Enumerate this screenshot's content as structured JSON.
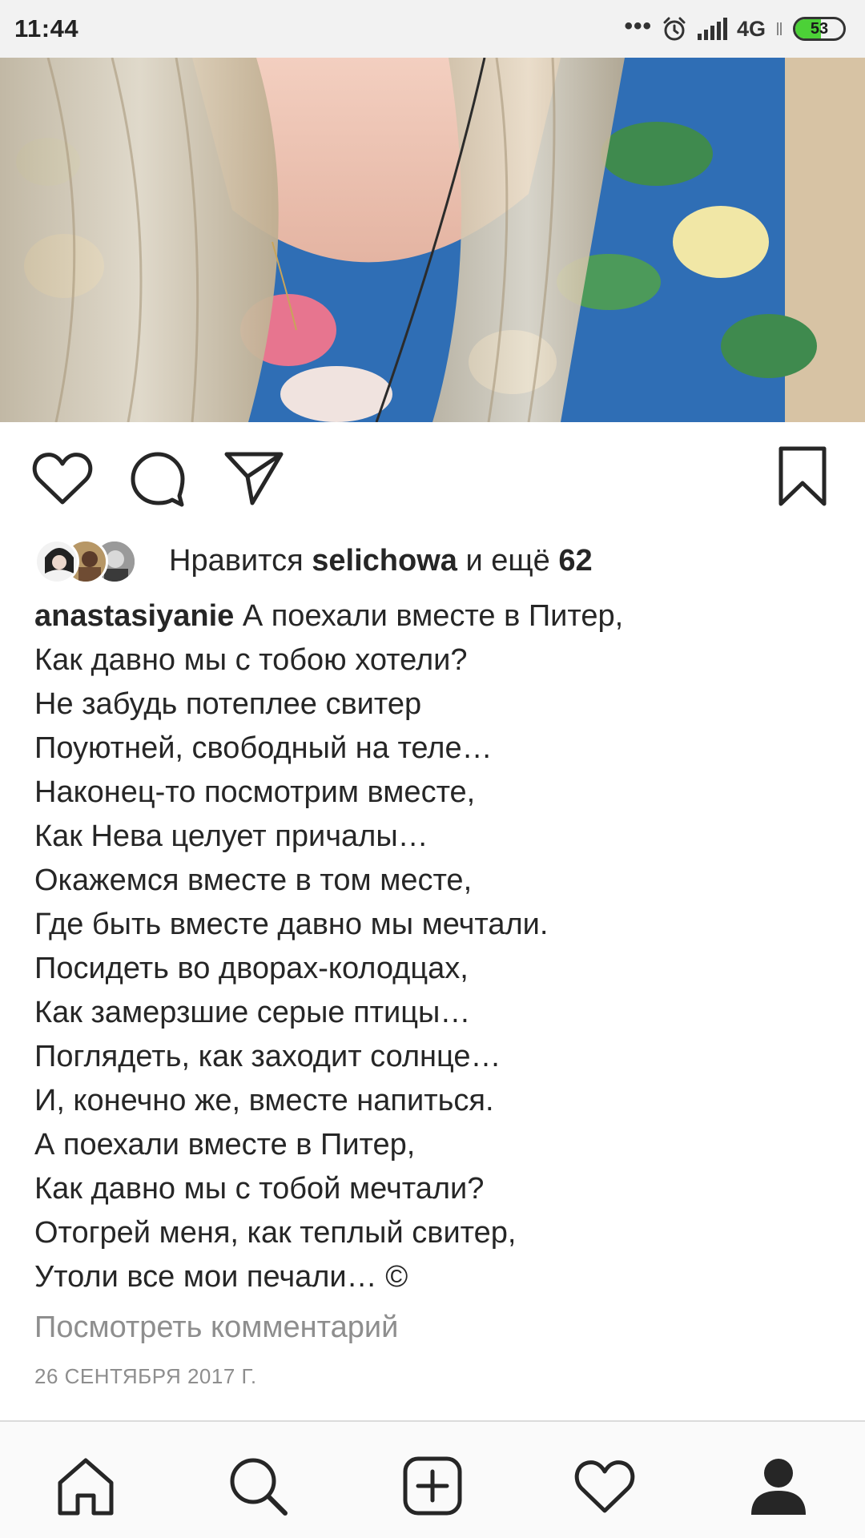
{
  "status_bar": {
    "time": "11:44",
    "dots": "•••",
    "network": "4G",
    "battery_level": "53",
    "battery_fraction": 0.53,
    "battery_color": "#4cd137",
    "icons": [
      "alarm-icon",
      "signal-icon",
      "battery-icon"
    ]
  },
  "post": {
    "image": "photo of blonde woman in blue floral top",
    "actions": [
      "heart-icon",
      "comment-icon",
      "send-icon",
      "bookmark-icon"
    ],
    "likes": {
      "prefix": "Нравится",
      "user": "selichowa",
      "middle": "и ещё",
      "count": "62"
    },
    "caption": {
      "username": "anastasiyanie",
      "first_line": "А поехали вместе в Питер,",
      "lines": [
        "Как давно мы с тобою хотели?",
        "Не забудь потеплее свитер",
        "Поуютней, свободный на теле…",
        "Наконец-то посмотрим вместе,",
        "Как Нева целует причалы…",
        "Окажемся вместе в том месте,",
        "Где быть вместе давно мы мечтали.",
        "Посидеть во дворах-колодцах,",
        "Как замерзшие серые птицы…",
        "Поглядеть, как заходит солнце…",
        "И, конечно же, вместе напиться.",
        "А поехали вместе в Питер,",
        "Как давно мы с тобой мечтали?",
        "Отогрей меня, как теплый свитер,",
        "Утоли все мои печали… ©"
      ]
    },
    "view_comments": "Посмотреть комментарий",
    "date": "26 СЕНТЯБРЯ 2017 Г."
  },
  "bottom_nav": {
    "items": [
      "home-icon",
      "search-icon",
      "add-post-icon",
      "activity-icon",
      "profile-icon"
    ],
    "active": "profile"
  }
}
